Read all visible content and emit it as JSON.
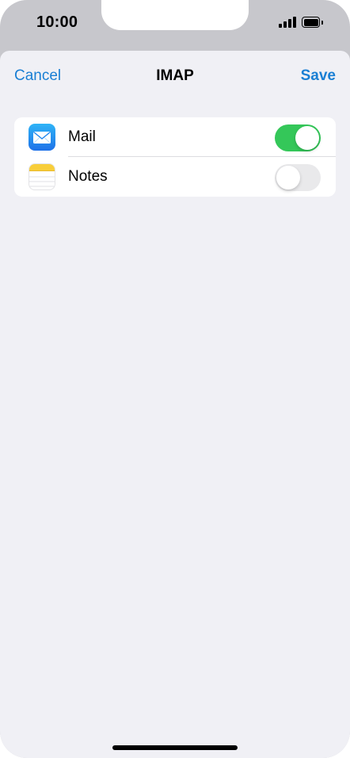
{
  "status_bar": {
    "time": "10:00",
    "signal_icon": "cellular-signal-icon",
    "battery_icon": "battery-icon"
  },
  "nav": {
    "cancel_label": "Cancel",
    "title": "IMAP",
    "save_label": "Save"
  },
  "settings": {
    "items": [
      {
        "label": "Mail",
        "icon": "mail-icon",
        "enabled": true
      },
      {
        "label": "Notes",
        "icon": "notes-icon",
        "enabled": false
      }
    ]
  },
  "colors": {
    "accent": "#1a7fd4",
    "toggle_on": "#34c759",
    "toggle_off": "#e9e9eb",
    "background": "#f0f0f5"
  }
}
